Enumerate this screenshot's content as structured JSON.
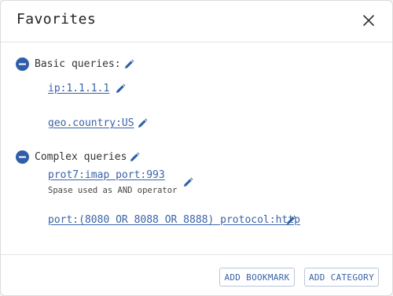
{
  "dialog": {
    "title": "Favorites",
    "close_icon": "close-icon"
  },
  "categories": [
    {
      "label": "Basic queries:",
      "icon": "minus-circle-icon",
      "queries": [
        {
          "text": "ip:1.1.1.1"
        },
        {
          "text": "geo.country:US"
        }
      ]
    },
    {
      "label": "Complex queries",
      "icon": "minus-circle-icon",
      "queries": [
        {
          "text": "prot7:imap port:993",
          "description": "Spase used as AND operator"
        },
        {
          "text": "port:(8080 OR 8088 OR 8888) protocol:http"
        }
      ]
    }
  ],
  "footer": {
    "add_bookmark": "ADD BOOKMARK",
    "add_category": "ADD CATEGORY"
  },
  "colors": {
    "accent": "#3a62a8",
    "icon_blue": "#2f5fa8",
    "text": "#333333"
  }
}
